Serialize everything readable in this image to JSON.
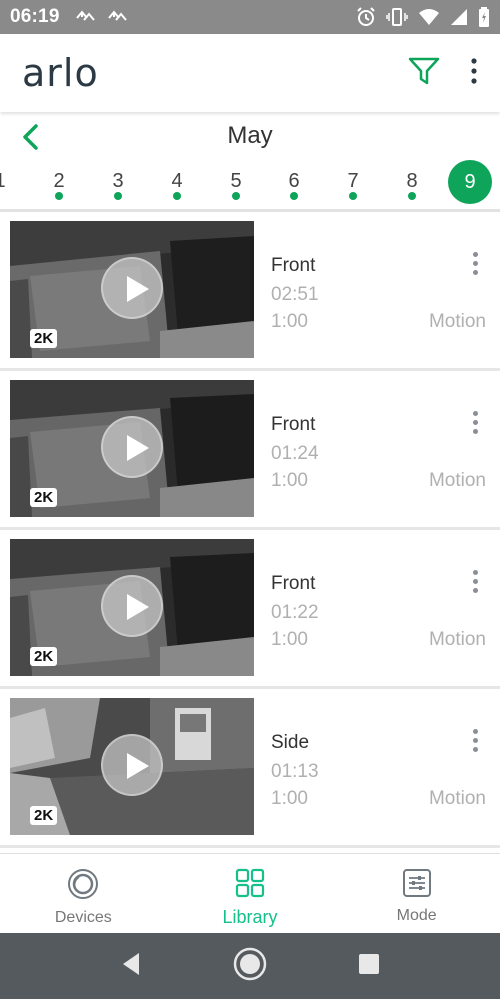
{
  "status_bar": {
    "time": "06:19",
    "left_icons": [
      "sync-icon",
      "sync-icon"
    ],
    "right_icons": [
      "alarm-icon",
      "vibrate-icon",
      "wifi-icon",
      "signal-icon",
      "battery-icon"
    ]
  },
  "app_bar": {
    "logo_text": "arlo",
    "filter_icon": "filter-icon",
    "menu_icon": "more-vert-icon",
    "accent": "#0ea45a"
  },
  "calendar": {
    "month": "May",
    "days": [
      "1",
      "2",
      "3",
      "4",
      "5",
      "6",
      "7",
      "8",
      "9"
    ],
    "selected_day": "9"
  },
  "clips": [
    {
      "camera": "Front",
      "time": "02:51",
      "duration": "1:00",
      "trigger": "Motion",
      "badge": "2K"
    },
    {
      "camera": "Front",
      "time": "01:24",
      "duration": "1:00",
      "trigger": "Motion",
      "badge": "2K"
    },
    {
      "camera": "Front",
      "time": "01:22",
      "duration": "1:00",
      "trigger": "Motion",
      "badge": "2K"
    },
    {
      "camera": "Side",
      "time": "01:13",
      "duration": "1:00",
      "trigger": "Motion",
      "badge": "2K"
    }
  ],
  "bottom_nav": {
    "items": [
      {
        "label": "Devices",
        "icon": "devices-icon"
      },
      {
        "label": "Library",
        "icon": "grid-icon"
      },
      {
        "label": "Mode",
        "icon": "mode-icon"
      }
    ],
    "active": "Library",
    "active_color": "#16c08a"
  }
}
